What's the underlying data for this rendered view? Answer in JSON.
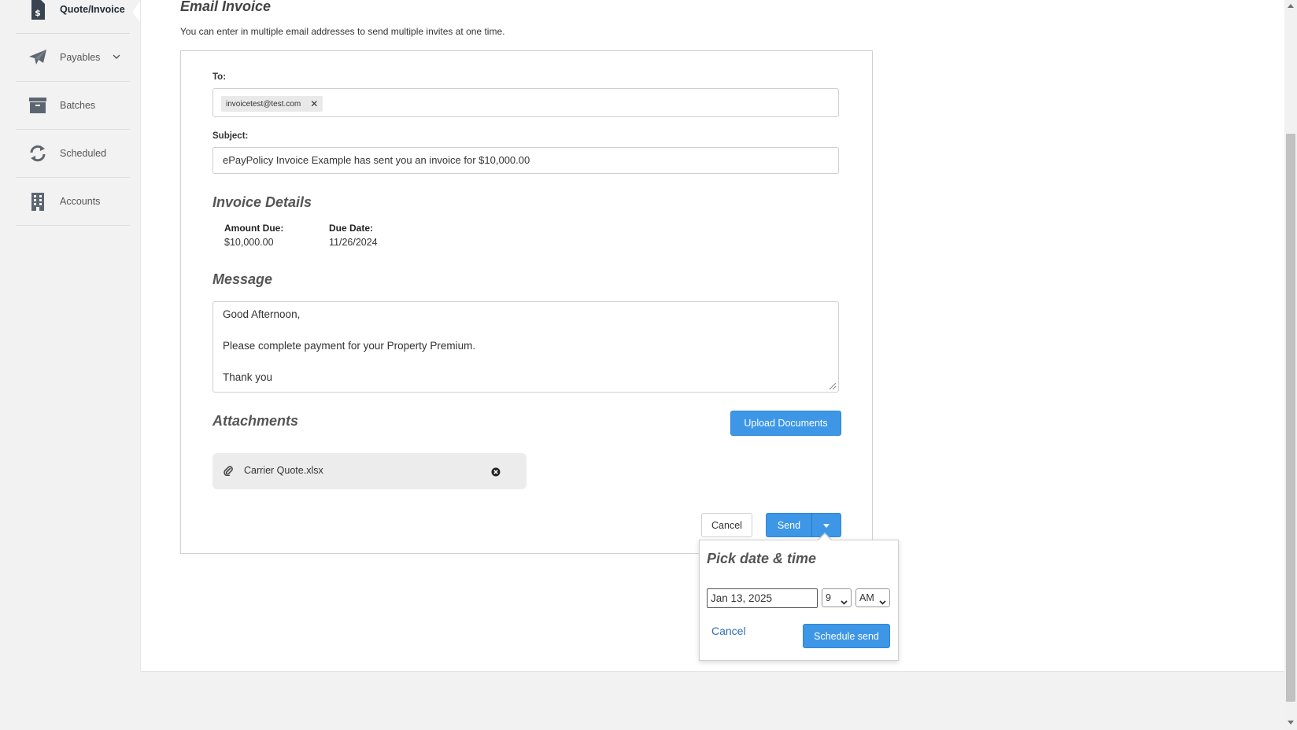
{
  "sidebar": {
    "items": [
      {
        "label": "Quote/Invoice",
        "icon": "invoice-dollar-icon"
      },
      {
        "label": "Payables",
        "icon": "paper-plane-icon"
      },
      {
        "label": "Batches",
        "icon": "archive-box-icon"
      },
      {
        "label": "Scheduled",
        "icon": "refresh-icon"
      },
      {
        "label": "Accounts",
        "icon": "building-icon"
      }
    ]
  },
  "page": {
    "title": "Email Invoice",
    "subtitle": "You can enter in multiple email addresses to send multiple invites at one time."
  },
  "form": {
    "to_label": "To:",
    "to_recipients": [
      "invoicetest@test.com"
    ],
    "remove_glyph": "✕",
    "subject_label": "Subject:",
    "subject_value": "ePayPolicy Invoice Example has sent you an invoice for $10,000.00",
    "invoice_details_heading": "Invoice Details",
    "amount_due_label": "Amount Due:",
    "amount_due_value": "$10,000.00",
    "due_date_label": "Due Date:",
    "due_date_value": "11/26/2024",
    "message_heading": "Message",
    "message_lines": [
      "Good Afternoon,",
      "",
      "Please complete payment for your Property Premium.",
      "",
      "Thank you"
    ],
    "attachments_heading": "Attachments",
    "upload_label": "Upload Documents",
    "attachment_name": "Carrier Quote.xlsx",
    "cancel_label": "Cancel",
    "send_label": "Send"
  },
  "schedule_popup": {
    "title": "Pick date & time",
    "date_value": "Jan 13, 2025",
    "hour_value": "9",
    "ampm_value": "AM",
    "cancel_label": "Cancel",
    "schedule_label": "Schedule send"
  },
  "colors": {
    "primary": "#3d97e6",
    "link": "#2f6eb5",
    "sidebar_bg": "#f2f2f2"
  }
}
